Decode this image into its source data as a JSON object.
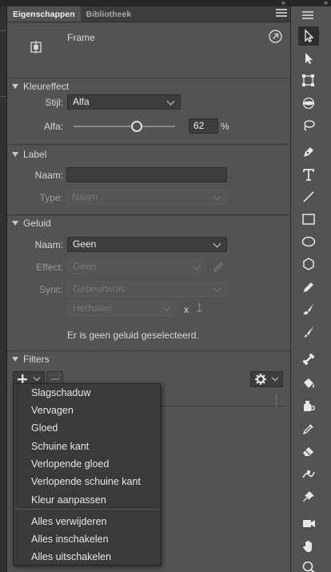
{
  "tabs": [
    {
      "label": "Eigenschappen",
      "active": true
    },
    {
      "label": "Bibliotheek",
      "active": false
    }
  ],
  "frame": {
    "title": "Frame"
  },
  "kleureffect": {
    "title": "Kleureffect",
    "stijl_label": "Stijl:",
    "stijl_value": "Alfa",
    "alfa_label": "Alfa:",
    "alfa_value": "62",
    "alfa_unit": "%",
    "alfa_fraction": 0.62
  },
  "label": {
    "title": "Label",
    "naam_label": "Naam:",
    "naam_value": "",
    "type_label": "Type:",
    "type_value": "Naam"
  },
  "geluid": {
    "title": "Geluid",
    "naam_label": "Naam:",
    "naam_value": "Geen",
    "effect_label": "Effect:",
    "effect_value": "Geen",
    "sync_label": "Sync:",
    "sync_value": "Gebeurtenis",
    "repeat_value": "Herhalen",
    "x_label": "x",
    "repeat_count": "1",
    "status": "Er is geen geluid geselecteerd."
  },
  "filters": {
    "title": "Filters",
    "menu_items": [
      "Slagschaduw",
      "Vervagen",
      "Gloed",
      "Schuine kant",
      "Verlopende gloed",
      "Verlopende schuine kant",
      "Kleur aanpassen"
    ],
    "menu_actions": [
      "Alles verwijderen",
      "Alles inschakelen",
      "Alles uitschakelen"
    ]
  },
  "tools": [
    "selection-tool-icon",
    "subselection-tool-icon",
    "free-transform-tool-icon",
    "3d-rotation-tool-icon",
    "lasso-tool-icon",
    "pen-tool-icon",
    "text-tool-icon",
    "line-tool-icon",
    "rectangle-tool-icon",
    "oval-tool-icon",
    "polystar-tool-icon",
    "pencil-tool-icon",
    "paint-brush-tool-icon",
    "brush-tool-icon",
    "bone-tool-icon",
    "paint-bucket-tool-icon",
    "ink-bottle-tool-icon",
    "eyedropper-tool-icon",
    "eraser-tool-icon",
    "width-tool-icon",
    "asset-warp-tool-icon",
    "camera-tool-icon",
    "hand-tool-icon",
    "zoom-tool-icon"
  ]
}
